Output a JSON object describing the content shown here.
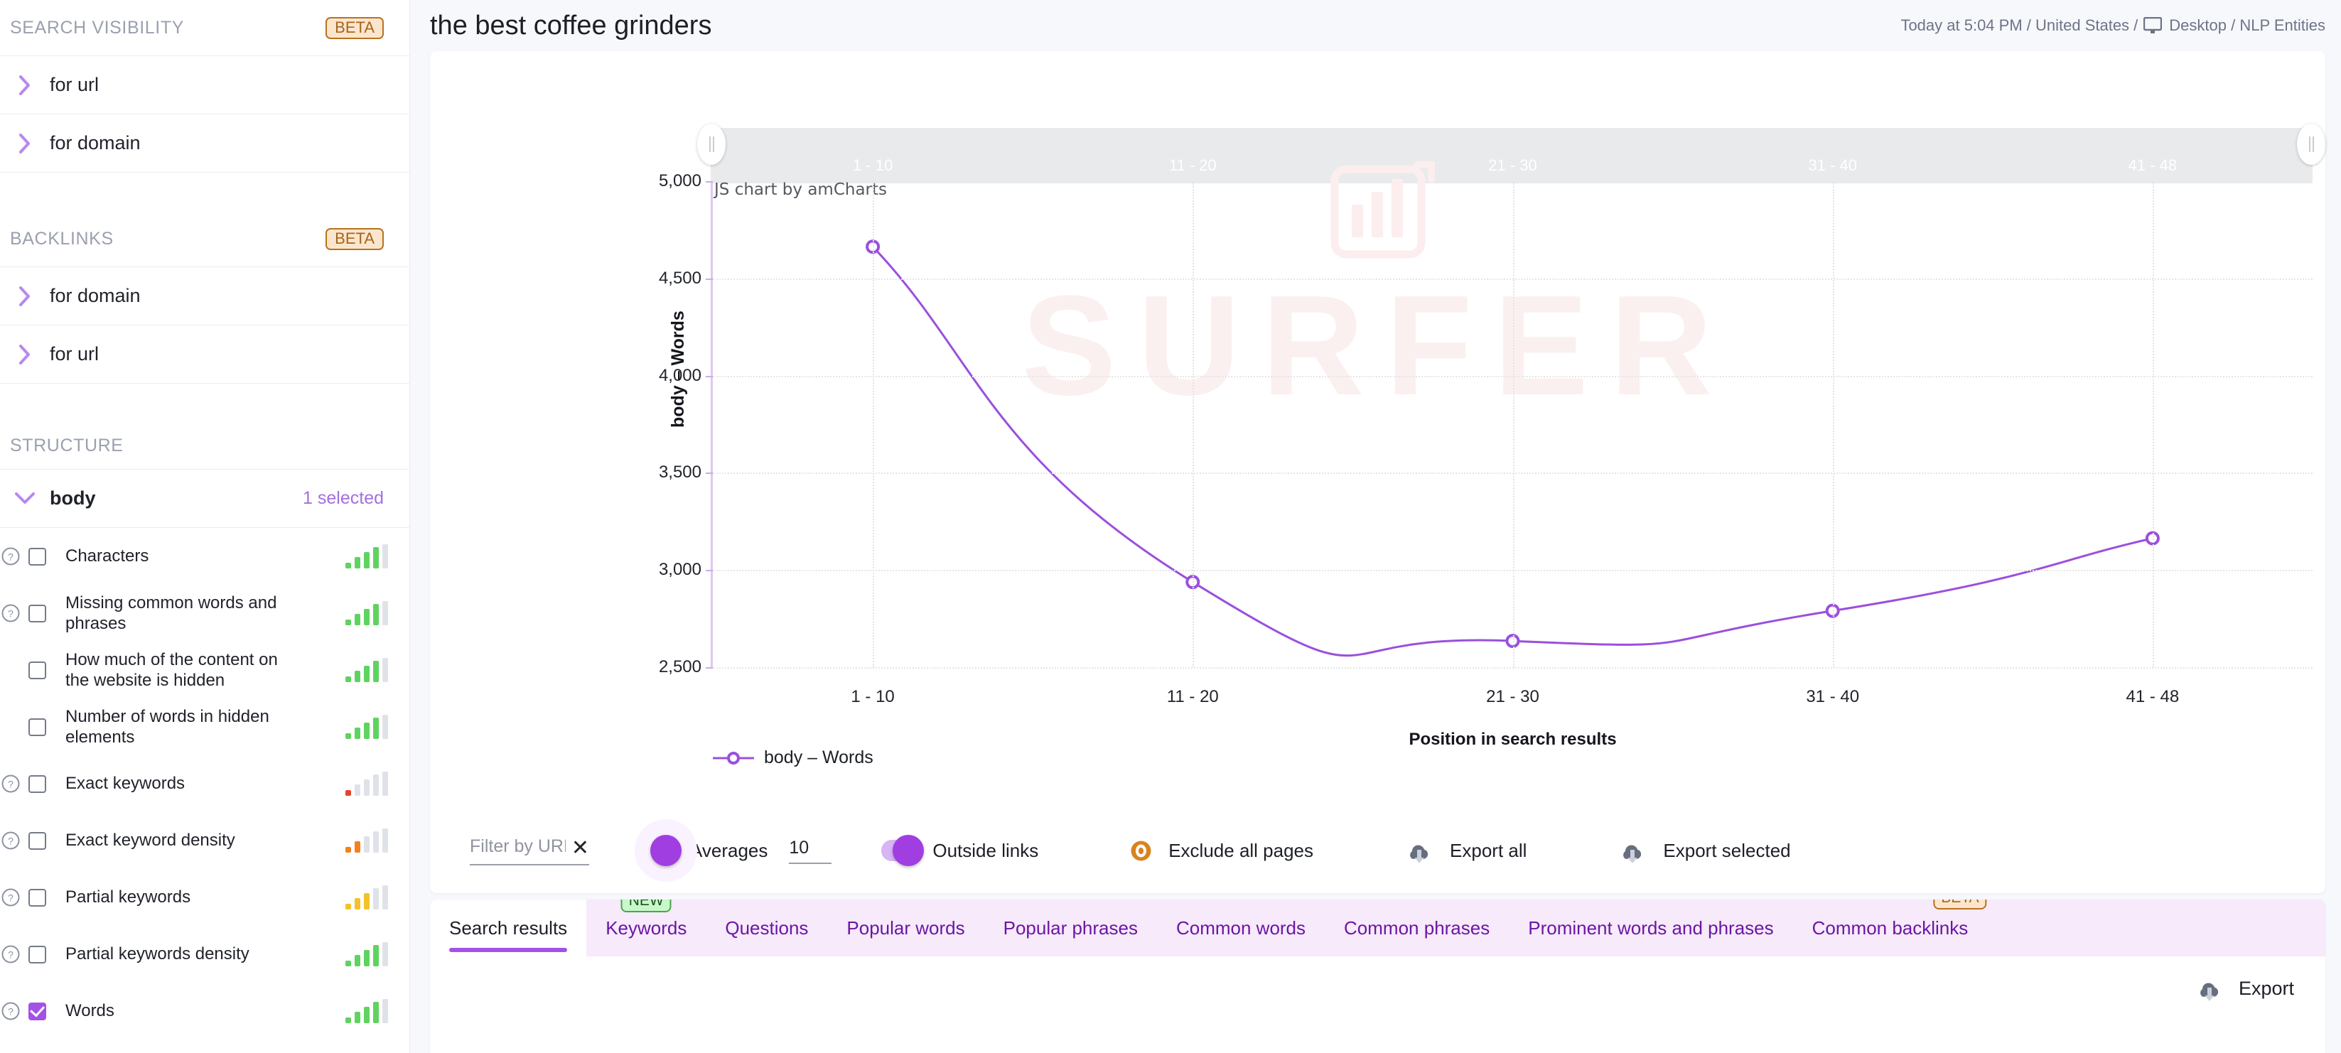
{
  "sidebar": {
    "sections": [
      {
        "title": "SEARCH VISIBILITY",
        "badge": "BETA",
        "rows": [
          {
            "label": "for url",
            "icon": "chevron-right-icon"
          },
          {
            "label": "for domain",
            "icon": "chevron-right-icon"
          }
        ]
      },
      {
        "title": "BACKLINKS",
        "badge": "BETA",
        "rows": [
          {
            "label": "for domain",
            "icon": "chevron-right-icon"
          },
          {
            "label": "for url",
            "icon": "chevron-right-icon"
          }
        ]
      }
    ],
    "structure": {
      "title": "STRUCTURE",
      "group": {
        "label": "body",
        "note": "1 selected",
        "icon": "chevron-down-icon"
      },
      "metrics": [
        {
          "label": "Characters",
          "checked": false,
          "help": true,
          "level": 4,
          "color": "#5fd35f"
        },
        {
          "label": "Missing common words and phrases",
          "checked": false,
          "help": true,
          "level": 4,
          "color": "#5fd35f"
        },
        {
          "label": "How much of the content on the website is hidden",
          "checked": false,
          "help": false,
          "level": 4,
          "color": "#5fd35f"
        },
        {
          "label": "Number of words in hidden elements",
          "checked": false,
          "help": false,
          "level": 4,
          "color": "#5fd35f"
        },
        {
          "label": "Exact keywords",
          "checked": false,
          "help": true,
          "level": 1,
          "color": "#e8412f"
        },
        {
          "label": "Exact keyword density",
          "checked": false,
          "help": true,
          "level": 2,
          "color": "#f0821e"
        },
        {
          "label": "Partial keywords",
          "checked": false,
          "help": true,
          "level": 3,
          "color": "#f2c22b"
        },
        {
          "label": "Partial keywords density",
          "checked": false,
          "help": true,
          "level": 4,
          "color": "#5fd35f"
        },
        {
          "label": "Words",
          "checked": true,
          "help": true,
          "level": 4,
          "color": "#5fd35f"
        }
      ]
    }
  },
  "header": {
    "title": "the best coffee grinders",
    "meta_time": "Today at 5:04 PM / United States / ",
    "meta_device": "Desktop / NLP Entities",
    "device_icon": "monitor-icon"
  },
  "chart_data": {
    "type": "line",
    "title": "",
    "credit": "JS chart by amCharts",
    "watermark": "SURFER",
    "categories": [
      "1 - 10",
      "11 - 20",
      "21 - 30",
      "31 - 40",
      "41 - 48"
    ],
    "series": [
      {
        "name": "body – Words",
        "values": [
          4663,
          2938,
          2635,
          2790,
          3163
        ],
        "color": "#9b4fdd"
      }
    ],
    "xlabel": "Position in search results",
    "ylabel": "body – Words",
    "ylim": [
      2500,
      5000
    ],
    "yticks": [
      "5,000",
      "4,500",
      "4,000",
      "3,500",
      "3,000",
      "2,500"
    ],
    "ytick_values": [
      5000,
      4500,
      4000,
      3500,
      3000,
      2500
    ],
    "grid": true,
    "legend_position": "bottom-left",
    "legend": [
      "body – Words"
    ],
    "range_selector": {
      "left_handle": "range-handle-left",
      "right_handle": "range-handle-right"
    }
  },
  "controls": {
    "filter_placeholder": "Filter by URL",
    "filter_value": "",
    "clear_icon": "close-icon",
    "averages_label": "Averages",
    "averages_on": true,
    "averages_value": "10",
    "outside_links_label": "Outside links",
    "outside_links_on": true,
    "exclude_label": "Exclude all pages",
    "exclude_icon": "eye-icon",
    "export_all_label": "Export all",
    "export_selected_label": "Export selected",
    "export_icon": "cloud-download-icon"
  },
  "tabs": {
    "items": [
      {
        "label": "Search results",
        "active": true,
        "tag": null
      },
      {
        "label": "Keywords",
        "active": false,
        "tag": "NEW",
        "tag_type": "new"
      },
      {
        "label": "Questions",
        "active": false,
        "tag": null
      },
      {
        "label": "Popular words",
        "active": false,
        "tag": null
      },
      {
        "label": "Popular phrases",
        "active": false,
        "tag": null
      },
      {
        "label": "Common words",
        "active": false,
        "tag": null
      },
      {
        "label": "Common phrases",
        "active": false,
        "tag": null
      },
      {
        "label": "Prominent words and phrases",
        "active": false,
        "tag": null
      },
      {
        "label": "Common backlinks",
        "active": false,
        "tag": "BETA",
        "tag_type": "beta"
      }
    ],
    "export_label": "Export"
  },
  "colors": {
    "accent_purple": "#a352e6",
    "line_purple": "#9b4fdd",
    "beta_orange": "#b9721f",
    "new_green": "#4aa64e",
    "tab_strip": "#f6eafb"
  }
}
